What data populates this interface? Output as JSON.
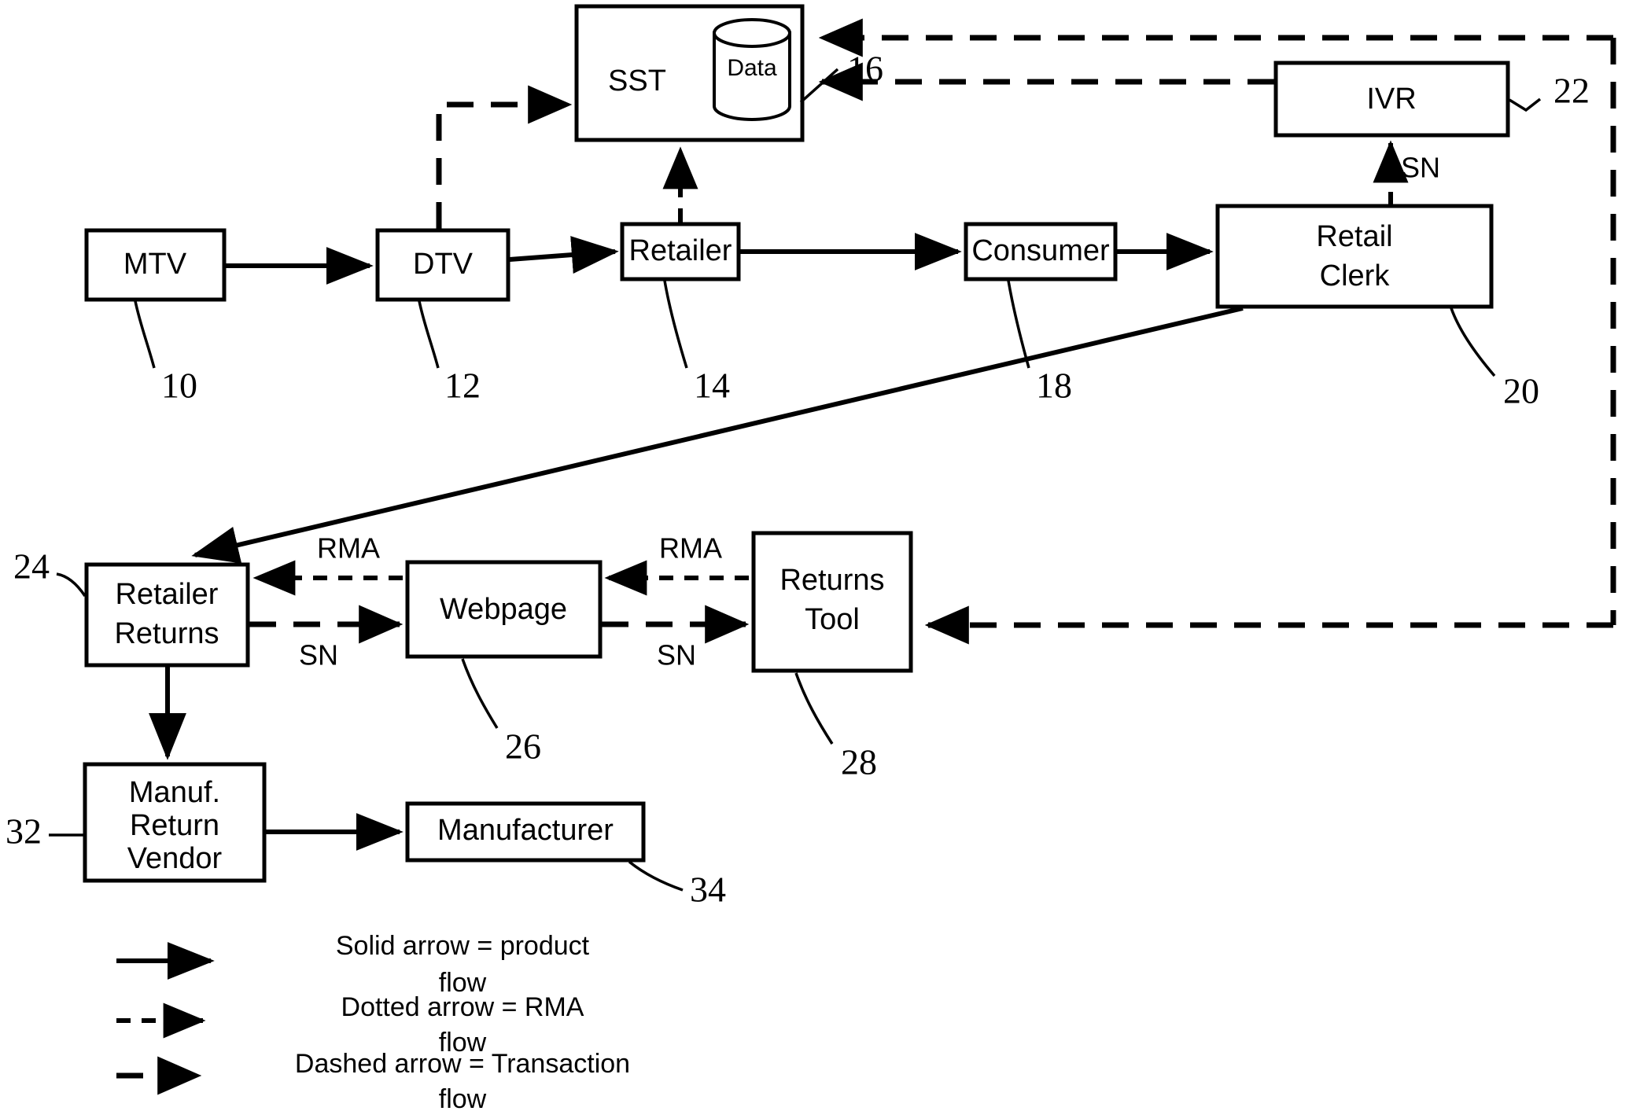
{
  "figure": {
    "type": "patent-flow-diagram",
    "background": "#ffffff",
    "ink": "#000000"
  },
  "nodes": {
    "sst": {
      "label": "SST",
      "ref": "16",
      "db_label": "Data"
    },
    "ivr": {
      "label": "IVR",
      "ref": "22"
    },
    "mtv": {
      "label": "MTV",
      "ref": "10"
    },
    "dtv": {
      "label": "DTV",
      "ref": "12"
    },
    "retailer": {
      "label": "Retailer",
      "ref": "14"
    },
    "consumer": {
      "label": "Consumer",
      "ref": "18"
    },
    "retail_clerk": {
      "label_line1": "Retail",
      "label_line2": "Clerk",
      "ref": "20"
    },
    "retailer_returns": {
      "label_line1": "Retailer",
      "label_line2": "Returns",
      "ref": "24"
    },
    "webpage": {
      "label": "Webpage",
      "ref": "26"
    },
    "returns_tool": {
      "label_line1": "Returns",
      "label_line2": "Tool",
      "ref": "28"
    },
    "manuf_return_vendor": {
      "label_line1": "Manuf.",
      "label_line2": "Return",
      "label_line3": "Vendor",
      "ref": "32"
    },
    "manufacturer": {
      "label": "Manufacturer",
      "ref": "34"
    }
  },
  "edge_labels": {
    "sn_ivr": "SN",
    "rma_webpage_to_retailer_returns": "RMA",
    "rma_returns_tool_to_webpage": "RMA",
    "sn_retailer_returns_to_webpage": "SN",
    "sn_webpage_to_returns_tool": "SN"
  },
  "legend": {
    "solid": {
      "line1": "Solid arrow = product",
      "line2": "flow"
    },
    "dotted": {
      "line1": "Dotted arrow = RMA",
      "line2": "flow"
    },
    "dashed": {
      "line1": "Dashed arrow = Transaction",
      "line2": "flow"
    }
  }
}
